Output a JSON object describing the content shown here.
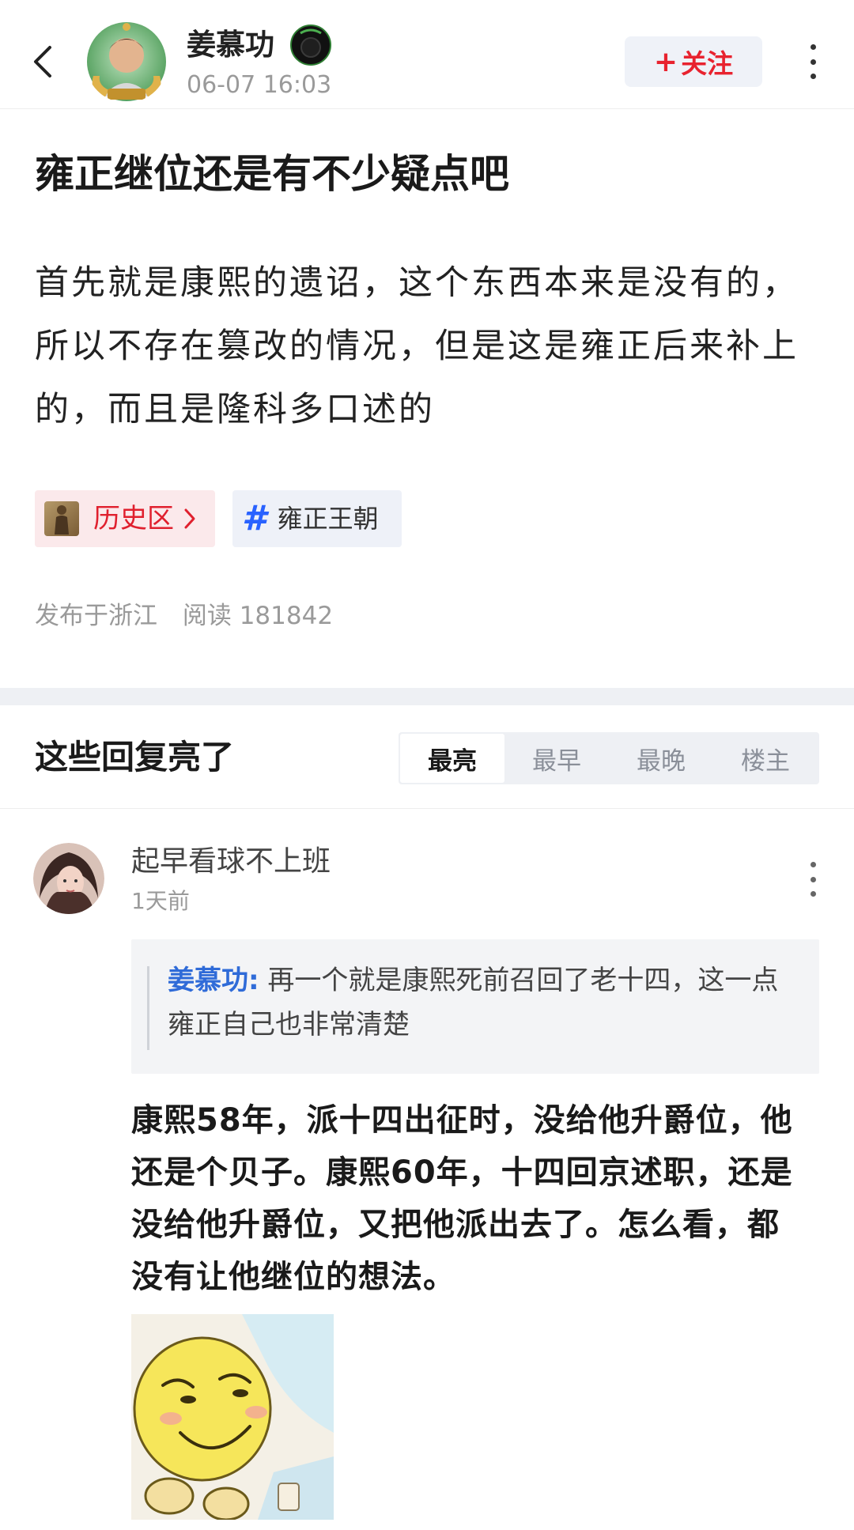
{
  "header": {
    "author_name": "姜慕功",
    "post_time": "06-07 16:03",
    "follow_label": "关注",
    "follow_plus": "+",
    "icons": {
      "back": "back-arrow-icon",
      "more": "more-vertical-icon",
      "badge": "badge-icon"
    }
  },
  "post": {
    "title": "雍正继位还是有不少疑点吧",
    "body": "首先就是康熙的遗诏，这个东西本来是没有的，所以不存在篡改的情况，但是这是雍正后来补上的，而且是隆科多口述的",
    "tags": {
      "history_label": "历史区",
      "topic_label": "雍正王朝",
      "topic_hash": "#"
    },
    "meta": {
      "location": "发布于浙江",
      "reads": "阅读 181842"
    }
  },
  "replies": {
    "section_title": "这些回复亮了",
    "sort_tabs": [
      "最亮",
      "最早",
      "最晚",
      "楼主"
    ],
    "active_tab": "最亮",
    "items": [
      {
        "username": "起早看球不上班",
        "time": "1天前",
        "quote_author": "姜慕功:",
        "quote_text": " 再一个就是康熙死前召回了老十四，这一点雍正自己也非常清楚",
        "body": "康熙58年，派十四出征时，没给他升爵位，他还是个贝子。康熙60年，十四回京述职，还是没给他升爵位，又把他派出去了。怎么看，都没有让他继位的想法。"
      }
    ]
  },
  "colors": {
    "accent_red": "#e8232f",
    "link_blue": "#2f6bd8",
    "hash_blue": "#2962ff",
    "muted": "#9a9a9a"
  }
}
